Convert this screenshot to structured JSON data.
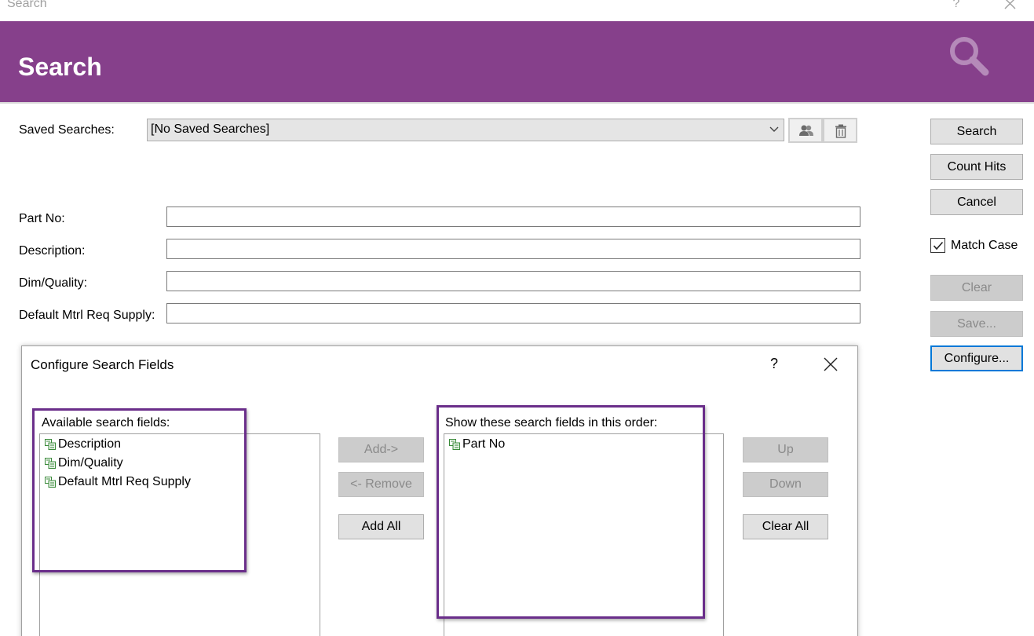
{
  "window": {
    "title": "Search",
    "help_label": "?",
    "close_icon": "close-icon"
  },
  "banner": {
    "title": "Search",
    "color": "#86408b",
    "icon": "search-icon"
  },
  "saved_searches": {
    "label": "Saved Searches:",
    "value": "[No Saved Searches]",
    "share_icon": "users-icon",
    "delete_icon": "trash-icon"
  },
  "fields": [
    {
      "label": "Part No:",
      "value": ""
    },
    {
      "label": "Description:",
      "value": ""
    },
    {
      "label": "Dim/Quality:",
      "value": ""
    },
    {
      "label": "Default Mtrl Req Supply:",
      "value": ""
    }
  ],
  "side_buttons": {
    "search": "Search",
    "count_hits": "Count Hits",
    "cancel": "Cancel",
    "match_case": "Match Case",
    "match_case_checked": true,
    "clear": "Clear",
    "save": "Save...",
    "configure": "Configure..."
  },
  "dialog": {
    "title": "Configure Search Fields",
    "help_label": "?",
    "available_label": "Available search fields:",
    "available_items": [
      "Description",
      "Dim/Quality",
      "Default Mtrl Req Supply"
    ],
    "selected_label": "Show these search fields in this order:",
    "selected_items": [
      "Part No"
    ],
    "add_label": "Add->",
    "remove_label": "<- Remove",
    "add_all_label": "Add All",
    "up_label": "Up",
    "down_label": "Down",
    "clear_all_label": "Clear All",
    "highlight_color": "#6a2e8a"
  }
}
